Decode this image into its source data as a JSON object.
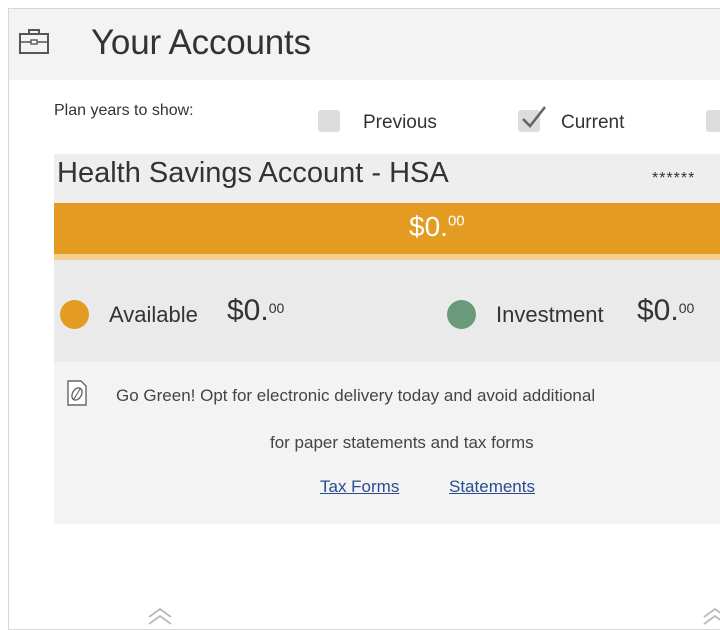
{
  "header": {
    "title": "Your Accounts",
    "icon": "briefcase-icon"
  },
  "plan_years": {
    "label": "Plan years to show:",
    "options": [
      {
        "label": "Previous",
        "checked": false
      },
      {
        "label": "Current",
        "checked": true
      },
      {
        "label": "",
        "checked": false
      }
    ]
  },
  "account": {
    "name": "Health Savings Account - HSA",
    "masked_number": "******",
    "balance_main": "$0.",
    "balance_cents": "00",
    "bar_color": "#e39b21",
    "available": {
      "label": "Available",
      "amount_main": "$0.",
      "amount_cents": "00",
      "color": "#e39b21"
    },
    "investment": {
      "label": "Investment",
      "amount_main": "$0.",
      "amount_cents": "00",
      "color": "#6a9a7a"
    }
  },
  "go_green": {
    "line1": "Go Green! Opt for electronic delivery today and avoid additional",
    "line2": "for paper statements and tax forms",
    "links": {
      "tax_forms": "Tax Forms",
      "statements": "Statements"
    },
    "icon": "leaf-document-icon"
  },
  "footer": {
    "icons": [
      "chevron-up-double-icon",
      "chevron-up-double-icon"
    ]
  }
}
